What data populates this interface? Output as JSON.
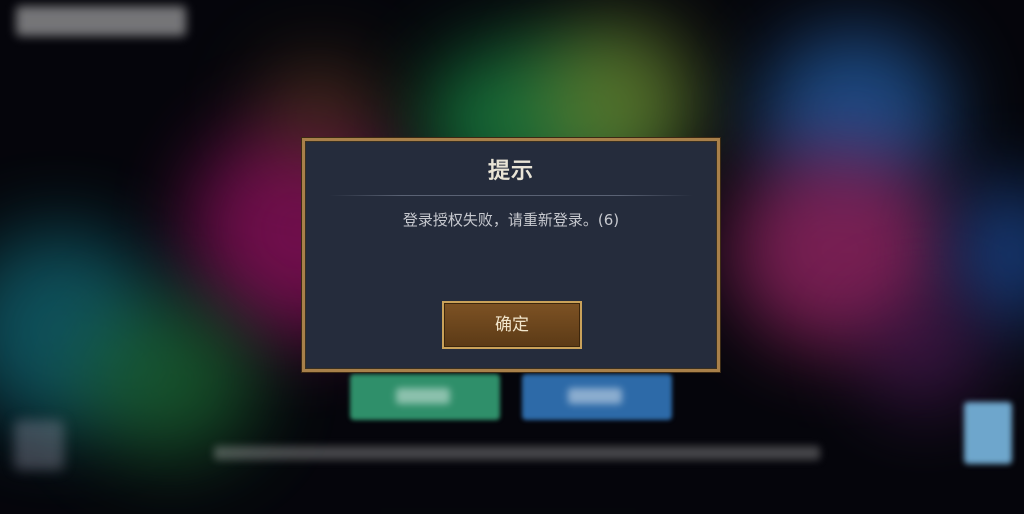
{
  "dialog": {
    "title": "提示",
    "message": "登录授权失败，请重新登录。(6)",
    "confirm_label": "确定"
  },
  "colors": {
    "dialog_bg": "#252c3c",
    "dialog_border": "#a8804a",
    "button_bg": "#6b4620",
    "button_border": "#caa25a"
  }
}
